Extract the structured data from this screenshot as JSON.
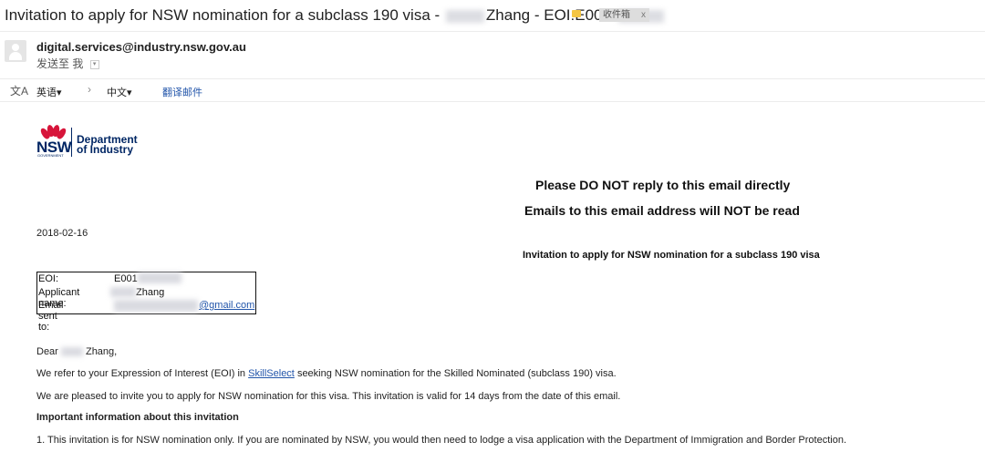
{
  "subject": {
    "prefix": "Invitation to apply for NSW nomination for a subclass 190 visa -",
    "name": "Zhang",
    "eoi": "- EOI:E0011"
  },
  "label_chip": {
    "text": "收件箱",
    "close": "x"
  },
  "sender": {
    "email": "digital.services@industry.nsw.gov.au",
    "to_me": "发送至 我",
    "caret": "▾"
  },
  "translate": {
    "icon": "文A",
    "source_lang": "英语",
    "arrow": "›",
    "target_lang": "中文",
    "action": "翻译邮件"
  },
  "logo": {
    "text": "NSW",
    "gov": "GOVERNMENT",
    "dept_line1": "Department",
    "dept_line2": "of Industry"
  },
  "notices": {
    "line1": "Please DO NOT reply to this email directly",
    "line2": "Emails to this email address will NOT be read"
  },
  "date": "2018-02-16",
  "invitation_title": "Invitation to apply for NSW nomination for a subclass 190 visa",
  "info_box": {
    "eoi_label": "EOI:",
    "eoi_value": "E001",
    "applicant_label": "Applicant name:",
    "applicant_value": "Zhang",
    "email_label": "Email sent to:",
    "email_value": "@gmail.com"
  },
  "body": {
    "greeting_prefix": "Dear",
    "greeting_name": "Zhang,",
    "p1_before": "We refer to your Expression of Interest (EOI) in",
    "p1_link": "SkillSelect",
    "p1_after": "seeking NSW nomination for the Skilled Nominated (subclass 190) visa.",
    "p2": "We are pleased to invite you to apply for NSW nomination for this visa. This invitation is valid for 14 days from the date of this email.",
    "important_heading": "Important information about this invitation",
    "item1": "1. This invitation is for NSW nomination only. If you are nominated by NSW, you would then need to lodge a visa application with the Department of Immigration and Border Protection."
  },
  "colors": {
    "link": "#2255aa",
    "nsw_red": "#d7153a",
    "nsw_blue": "#002664",
    "label_yellow": "#f4c542"
  }
}
